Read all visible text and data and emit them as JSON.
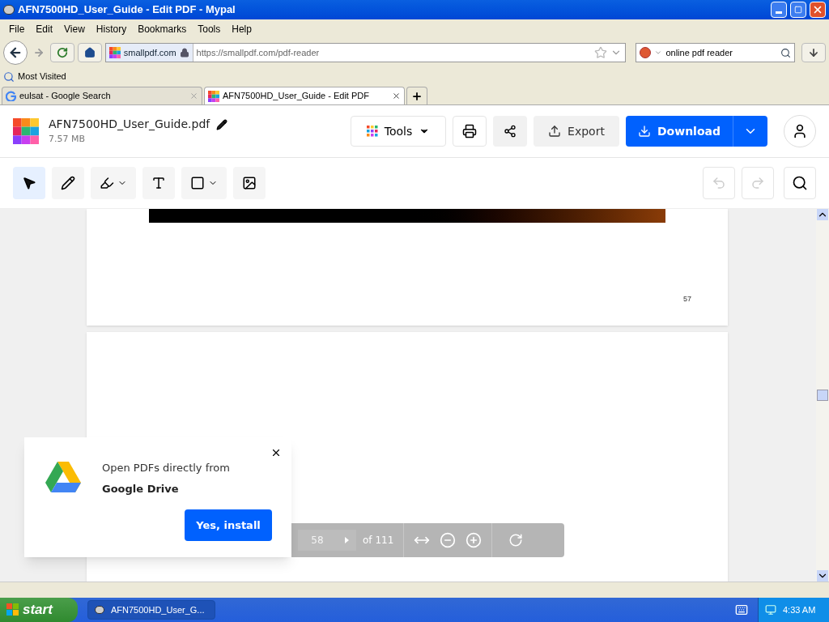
{
  "window": {
    "title": "AFN7500HD_User_Guide - Edit PDF - Mypal"
  },
  "menu": [
    "File",
    "Edit",
    "View",
    "History",
    "Bookmarks",
    "Tools",
    "Help"
  ],
  "navbar": {
    "site": "smallpdf.com",
    "url": "https://smallpdf.com/pdf-reader",
    "search": "online pdf reader"
  },
  "bookmarks": [
    "Most Visited"
  ],
  "tabs": [
    {
      "label": "eulsat - Google Search",
      "kind": "google",
      "selected": false
    },
    {
      "label": "AFN7500HD_User_Guide - Edit PDF",
      "kind": "smallpdf",
      "selected": true
    }
  ],
  "app": {
    "file_name": "AFN7500HD_User_Guide.pdf",
    "file_size": "7.57 MB",
    "tools": "Tools",
    "export": "Export",
    "download": "Download"
  },
  "toolbar": [
    {
      "kind": "select",
      "selected": true
    },
    {
      "kind": "pencil",
      "selected": false
    },
    {
      "kind": "highlighter",
      "selected": false
    },
    {
      "kind": "text",
      "selected": false
    },
    {
      "kind": "shape",
      "selected": false
    },
    {
      "kind": "image",
      "selected": false
    }
  ],
  "history": [
    {
      "kind": "undo",
      "disabled": true
    },
    {
      "kind": "redo",
      "disabled": true
    }
  ],
  "document": {
    "page_number": "57"
  },
  "pager": {
    "page": "58",
    "total": "of 111"
  },
  "popup": {
    "message": "Open PDFs directly from",
    "emphasis": "Google Drive",
    "button": "Yes, install"
  },
  "taskbar": {
    "start": "start",
    "task": "AFN7500HD_User_G...",
    "clock": "4:33 AM"
  }
}
